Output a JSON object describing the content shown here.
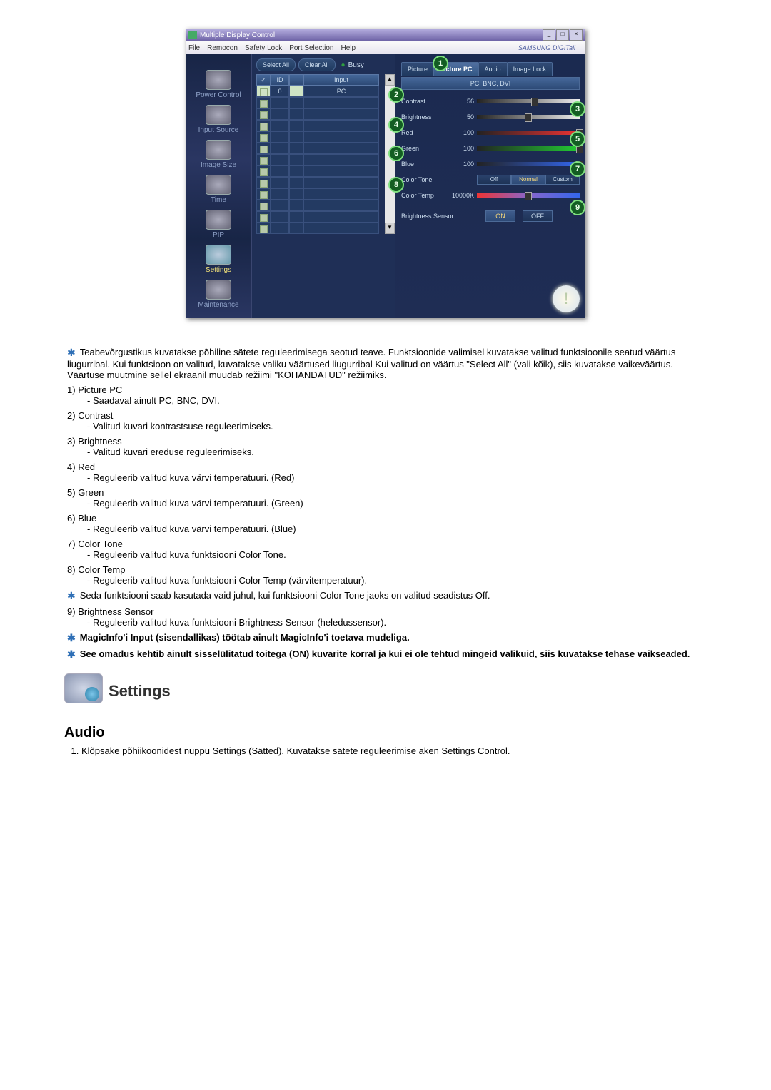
{
  "app": {
    "title": "Multiple Display Control",
    "brand": "SAMSUNG DIGITall",
    "menu": [
      "File",
      "Remocon",
      "Safety Lock",
      "Port Selection",
      "Help"
    ],
    "select_all": "Select All",
    "clear_all": "Clear All",
    "busy": "Busy"
  },
  "sidebar": {
    "items": [
      {
        "label": "Power Control"
      },
      {
        "label": "Input Source"
      },
      {
        "label": "Image Size"
      },
      {
        "label": "Time"
      },
      {
        "label": "PIP"
      },
      {
        "label": "Settings"
      },
      {
        "label": "Maintenance"
      }
    ]
  },
  "grid": {
    "head": {
      "c2": "ID",
      "c4": "Input"
    },
    "row0": {
      "id": "0",
      "input": "PC"
    }
  },
  "tabs": {
    "t1": "Picture",
    "t2": "Picture PC",
    "t3": "Audio",
    "t4": "Image Lock"
  },
  "info": "PC, BNC, DVI",
  "sliders": {
    "contrast": {
      "label": "Contrast",
      "value": "56"
    },
    "brightness": {
      "label": "Brightness",
      "value": "50"
    },
    "red": {
      "label": "Red",
      "value": "100"
    },
    "green": {
      "label": "Green",
      "value": "100"
    },
    "blue": {
      "label": "Blue",
      "value": "100"
    },
    "ctone": {
      "label": "Color Tone"
    },
    "ctone_opts": {
      "o1": "Off",
      "o2": "Normal",
      "o3": "Custom"
    },
    "ctemp": {
      "label": "Color Temp",
      "value": "10000K"
    },
    "bsensor": {
      "label": "Brightness Sensor",
      "on": "ON",
      "off": "OFF"
    }
  },
  "doc": {
    "main_note": "Teabevõrgustikus kuvatakse põhiline sätete reguleerimisega seotud teave. Funktsioonide valimisel kuvatakse valitud funktsioonile seatud väärtus liugurribal. Kui funktsioon on valitud, kuvatakse valiku väärtused liugurribal Kui valitud on väärtus \"Select All\" (vali kõik), siis kuvatakse vaikeväärtus. Väärtuse muutmine sellel ekraanil muudab režiimi \"KOHANDATUD\" režiimiks.",
    "items": [
      {
        "n": "1)",
        "t": "Picture PC",
        "s": "- Saadaval ainult PC, BNC, DVI."
      },
      {
        "n": "2)",
        "t": "Contrast",
        "s": "- Valitud kuvari kontrastsuse reguleerimiseks."
      },
      {
        "n": "3)",
        "t": "Brightness",
        "s": "- Valitud kuvari ereduse reguleerimiseks."
      },
      {
        "n": "4)",
        "t": "Red",
        "s": "- Reguleerib valitud kuva värvi temperatuuri. (Red)"
      },
      {
        "n": "5)",
        "t": "Green",
        "s": "- Reguleerib valitud kuva värvi temperatuuri. (Green)"
      },
      {
        "n": "6)",
        "t": "Blue",
        "s": "- Reguleerib valitud kuva värvi temperatuuri. (Blue)"
      },
      {
        "n": "7)",
        "t": "Color Tone",
        "s": "- Reguleerib valitud kuva funktsiooni Color Tone."
      },
      {
        "n": "8)",
        "t": "Color Temp",
        "s": "- Reguleerib valitud kuva funktsiooni Color Temp (värvitemperatuur)."
      }
    ],
    "star2": "Seda funktsiooni saab kasutada vaid juhul, kui funktsiooni Color Tone jaoks on valitud seadistus Off.",
    "item9n": "9)",
    "item9t": "Brightness Sensor",
    "item9s": "- Reguleerib valitud kuva funktsiooni Brightness Sensor (heledussensor).",
    "star3": "MagicInfo'i Input (sisendallikas) töötab ainult MagicInfo'i toetava mudeliga.",
    "star4": "See omadus kehtib ainult sisselülitatud toitega (ON) kuvarite korral ja kui ei ole tehtud mingeid valikuid, siis kuvatakse tehase vaikseaded.",
    "settings_head": "Settings",
    "audio_head": "Audio",
    "audio_step": "Klõpsake põhiikoonidest nuppu Settings (Sätted). Kuvatakse sätete reguleerimise aken Settings Control."
  }
}
